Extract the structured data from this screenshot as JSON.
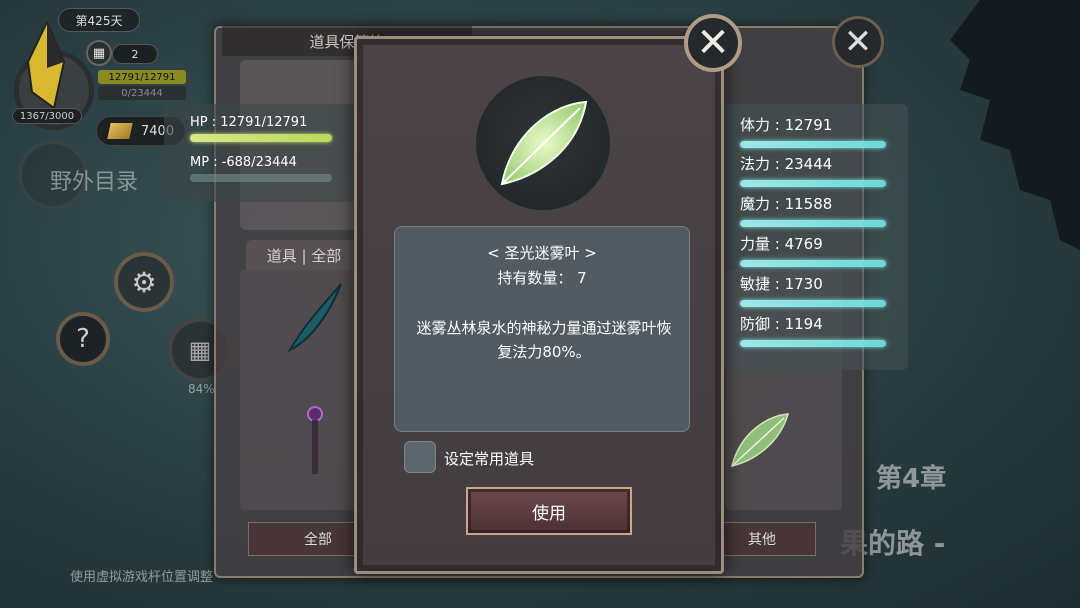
{
  "hud": {
    "day": "第425天",
    "calendar_count": "2",
    "hp_mini": "12791/12791",
    "mp_mini": "0/23444",
    "exp": "1367/3000",
    "gold": "7400",
    "field_menu": "野外目录",
    "progress_pct": "84%",
    "hint": "使用虚拟游戏杆位置调整",
    "chapter": "第4章",
    "path_text": "果的路 -"
  },
  "storage": {
    "title": "道具保管箱",
    "tab_header": "道具 | 全部",
    "all_label": "全部",
    "other_label": "其他"
  },
  "vitals": {
    "hp": "HP : 12791/12791",
    "mp": "MP : -688/23444"
  },
  "stats": [
    {
      "label": "体力 : 12791"
    },
    {
      "label": "法力 : 23444"
    },
    {
      "label": "魔力 : 11588"
    },
    {
      "label": "力量 : 4769"
    },
    {
      "label": "敏捷 : 1730"
    },
    {
      "label": "防御 : 1194"
    }
  ],
  "item": {
    "name": "< 圣光迷雾叶 >",
    "quantity": "持有数量： 7",
    "description": "迷雾丛林泉水的神秘力量通过迷雾叶恢复法力80%。",
    "set_common_label": "设定常用道具",
    "use_label": "使用"
  },
  "colors": {
    "hp_bar": "#c8e070",
    "stat_bar": "#7ee0e0",
    "modal_border": "#9c8e7c",
    "use_button": "#5a3c40"
  },
  "icons": [
    "close-icon",
    "leaf-icon",
    "gear-icon",
    "help-icon",
    "calendar-icon",
    "gold-icon",
    "crystal-icon",
    "feather-icon",
    "wand-icon"
  ]
}
